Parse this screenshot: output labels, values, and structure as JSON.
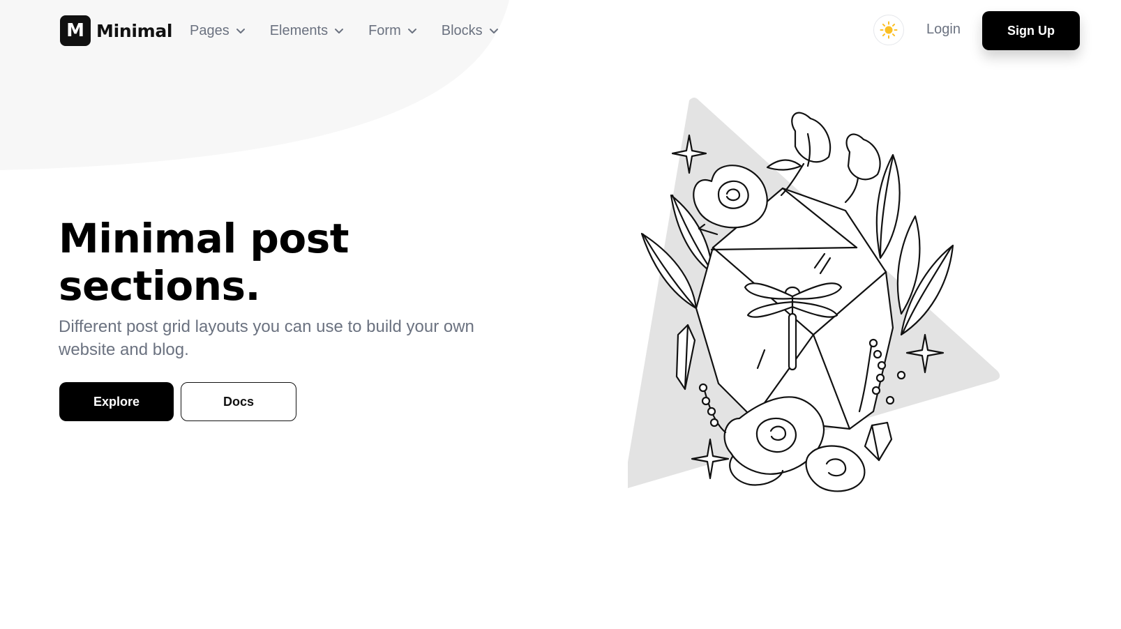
{
  "brand": {
    "logo_letter": "M",
    "name": "Minimal"
  },
  "nav": {
    "items": [
      {
        "label": "Pages"
      },
      {
        "label": "Elements"
      },
      {
        "label": "Form"
      },
      {
        "label": "Blocks"
      }
    ]
  },
  "header": {
    "theme_toggle_icon": "sun-icon",
    "login_label": "Login",
    "signup_label": "Sign Up"
  },
  "hero": {
    "title_line1": "Minimal post",
    "title_line2": "sections.",
    "subtitle": "Different post grid layouts you can use to build your own website and blog.",
    "explore_label": "Explore",
    "docs_label": "Docs",
    "illustration_icon": "crystal-flowers-illustration"
  },
  "colors": {
    "primary": "#000000",
    "muted_text": "#6b7280",
    "sun": "#fbbf24",
    "blob": "#f7f7f7",
    "triangle": "#e3e3e3"
  }
}
